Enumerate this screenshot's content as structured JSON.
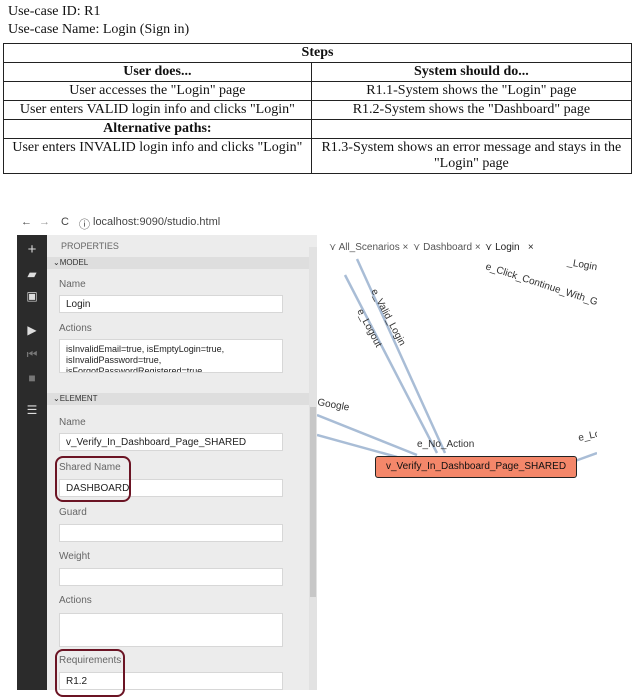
{
  "use_case": {
    "id_line": "Use-case ID: R1",
    "name_line": "Use-case Name: Login (Sign in)",
    "steps_header": "Steps",
    "col_user": "User does...",
    "col_system": "System should do...",
    "rows": [
      {
        "user": "User accesses the \"Login\" page",
        "system": "R1.1-System shows the \"Login\" page"
      },
      {
        "user": "User enters VALID login info and clicks \"Login\"",
        "system": "R1.2-System shows the \"Dashboard\" page"
      }
    ],
    "alt_header": "Alternative paths:",
    "alt_rows": [
      {
        "user": "User enters INVALID login info and clicks \"Login\"",
        "system": "R1.3-System shows an error message and stays in the \"Login\" page"
      }
    ]
  },
  "browser": {
    "back": "←",
    "forward": "→",
    "reload": "C",
    "info": "ⓘ",
    "url": "localhost:9090/studio.html"
  },
  "sidebar": {
    "plus": "+",
    "folder": "▰",
    "save": "▣",
    "play": "▶",
    "step": "⏮",
    "stop": "■",
    "list": "☰"
  },
  "properties": {
    "title": "PROPERTIES",
    "model_section": "MODEL",
    "model_name_label": "Name",
    "model_name_value": "Login",
    "model_actions_label": "Actions",
    "model_actions_value": "isInvalidEmail=true, isEmptyLogin=true, isInvalidPassword=true, isForgotPasswordRegistered=true",
    "element_section": "ELEMENT",
    "element_name_label": "Name",
    "element_name_value": "v_Verify_In_Dashboard_Page_SHARED",
    "shared_name_label": "Shared Name",
    "shared_name_value": "DASHBOARD",
    "guard_label": "Guard",
    "weight_label": "Weight",
    "actions_label": "Actions",
    "requirements_label": "Requirements",
    "requirements_value": "R1.2"
  },
  "graph": {
    "tabs": [
      {
        "label": "All_Scenarios",
        "close": "×"
      },
      {
        "label": "Dashboard",
        "close": "×"
      },
      {
        "label": "Login",
        "close": "×"
      }
    ],
    "edges": [
      "e_Click_Continue_With_Github",
      "e_Valid_Login",
      "e_Logout",
      "Google",
      "e_No_Action",
      "e_Lo",
      "_Login"
    ],
    "vertex_label": "v_Verify_In_Dashboard_Page_SHARED",
    "vertex_color": "#f4876a"
  },
  "colors": {
    "highlight_box": "#6b1424",
    "edge": "#a9bdd6"
  }
}
